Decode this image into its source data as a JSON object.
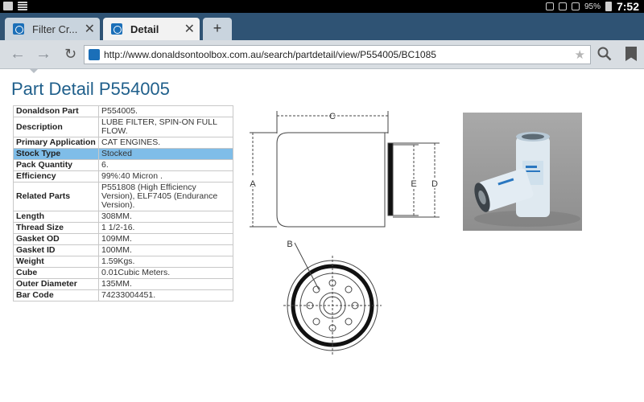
{
  "statusbar": {
    "battery": "95%",
    "time": "7:52"
  },
  "tabs": [
    {
      "label": "Filter Cr...",
      "active": false
    },
    {
      "label": "Detail",
      "active": true
    }
  ],
  "new_tab_label": "+",
  "close_glyph": "✕",
  "address": {
    "url": "http://www.donaldsontoolbox.com.au/search/partdetail/view/P554005/BC1085"
  },
  "icons": {
    "back": "arrow-left-icon",
    "forward": "arrow-right-icon",
    "reload": "reload-icon",
    "star": "star-icon",
    "search": "search-icon",
    "bookmarks": "bookmarks-icon"
  },
  "page": {
    "title": "Part Detail P554005"
  },
  "specs": [
    {
      "k": "Donaldson Part",
      "v": "P554005."
    },
    {
      "k": "Description",
      "v": "LUBE FILTER, SPIN-ON FULL FLOW."
    },
    {
      "k": "Primary Application",
      "v": "CAT ENGINES."
    },
    {
      "k": "Stock Type",
      "v": "Stocked"
    },
    {
      "k": "Pack Quantity",
      "v": "6."
    },
    {
      "k": "Efficiency",
      "v": "99%:40 Micron ."
    },
    {
      "k": "Related Parts",
      "v": "P551808 (High Efficiency Version), ELF7405 (Endurance Version)."
    },
    {
      "k": "Length",
      "v": "308MM."
    },
    {
      "k": "Thread Size",
      "v": "1 1/2-16."
    },
    {
      "k": "Gasket OD",
      "v": "109MM."
    },
    {
      "k": "Gasket ID",
      "v": "100MM."
    },
    {
      "k": "Weight",
      "v": "1.59Kgs."
    },
    {
      "k": "Cube",
      "v": "0.01Cubic Meters."
    },
    {
      "k": "Outer Diameter",
      "v": "135MM."
    },
    {
      "k": "Bar Code",
      "v": "74233004451."
    }
  ],
  "diagram": {
    "label_a": "A",
    "label_b": "B",
    "label_c": "C",
    "label_d": "D",
    "label_e": "E"
  },
  "highlight_color": "#7fbde8",
  "title_color": "#1f5f8b"
}
